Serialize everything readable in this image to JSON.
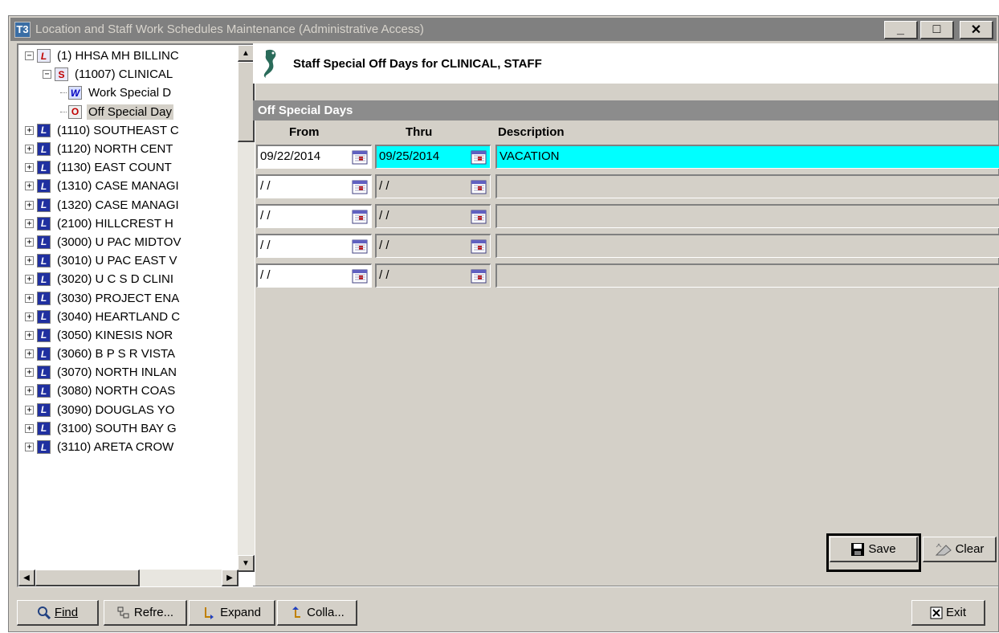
{
  "window": {
    "app_icon": "T3",
    "title": "Location and Staff Work Schedules Maintenance (Administrative Access)",
    "minimize": "_",
    "maximize": "□",
    "close": "✕"
  },
  "tree": {
    "items": [
      {
        "label": "(1) HHSA MH BILLINC",
        "icon": "L",
        "expander": "−"
      },
      {
        "label": "(11007) CLINICAL",
        "icon": "S",
        "expander": "−"
      },
      {
        "label": "Work Special D",
        "icon": "W"
      },
      {
        "label": "Off Special Day",
        "icon": "O"
      },
      {
        "label": "(1110) SOUTHEAST C",
        "icon": "L",
        "expander": "+"
      },
      {
        "label": "(1120) NORTH CENT",
        "icon": "L",
        "expander": "+"
      },
      {
        "label": "(1130) EAST COUNT",
        "icon": "L",
        "expander": "+"
      },
      {
        "label": "(1310) CASE MANAGI",
        "icon": "L",
        "expander": "+"
      },
      {
        "label": "(1320) CASE MANAGI",
        "icon": "L",
        "expander": "+"
      },
      {
        "label": "(2100) HILLCREST H",
        "icon": "L",
        "expander": "+"
      },
      {
        "label": "(3000) U PAC MIDTOV",
        "icon": "L",
        "expander": "+"
      },
      {
        "label": "(3010) U PAC EAST V",
        "icon": "L",
        "expander": "+"
      },
      {
        "label": "(3020) U C S D CLINI",
        "icon": "L",
        "expander": "+"
      },
      {
        "label": "(3030) PROJECT ENA",
        "icon": "L",
        "expander": "+"
      },
      {
        "label": "(3040) HEARTLAND C",
        "icon": "L",
        "expander": "+"
      },
      {
        "label": "(3050) KINESIS NOR",
        "icon": "L",
        "expander": "+"
      },
      {
        "label": "(3060) B P S R VISTA",
        "icon": "L",
        "expander": "+"
      },
      {
        "label": "(3070) NORTH INLAN",
        "icon": "L",
        "expander": "+"
      },
      {
        "label": "(3080) NORTH COAS",
        "icon": "L",
        "expander": "+"
      },
      {
        "label": "(3090) DOUGLAS YO",
        "icon": "L",
        "expander": "+"
      },
      {
        "label": "(3100) SOUTH BAY G",
        "icon": "L",
        "expander": "+"
      },
      {
        "label": "(3110) ARETA CROW",
        "icon": "L",
        "expander": "+"
      }
    ]
  },
  "main": {
    "header_title": "Staff Special Off Days for CLINICAL, STAFF",
    "section_title": "Off Special Days",
    "columns": {
      "from": "From",
      "thru": "Thru",
      "description": "Description"
    },
    "rows": [
      {
        "from": "09/22/2014",
        "thru": "09/25/2014",
        "description": "VACATION"
      },
      {
        "from": "/ /",
        "thru": "/ /",
        "description": ""
      },
      {
        "from": "/ /",
        "thru": "/ /",
        "description": ""
      },
      {
        "from": "/ /",
        "thru": "/ /",
        "description": ""
      },
      {
        "from": "/ /",
        "thru": "/ /",
        "description": ""
      }
    ],
    "save_label": "Save",
    "clear_label": "Clear"
  },
  "bottom": {
    "find": "Find",
    "refresh": "Refre...",
    "expand": "Expand",
    "collapse": "Colla...",
    "exit": "Exit"
  },
  "colors": {
    "selection_row": "#00ffff",
    "section_bar": "#8c8c8c",
    "window_bg": "#d4d0c8"
  }
}
